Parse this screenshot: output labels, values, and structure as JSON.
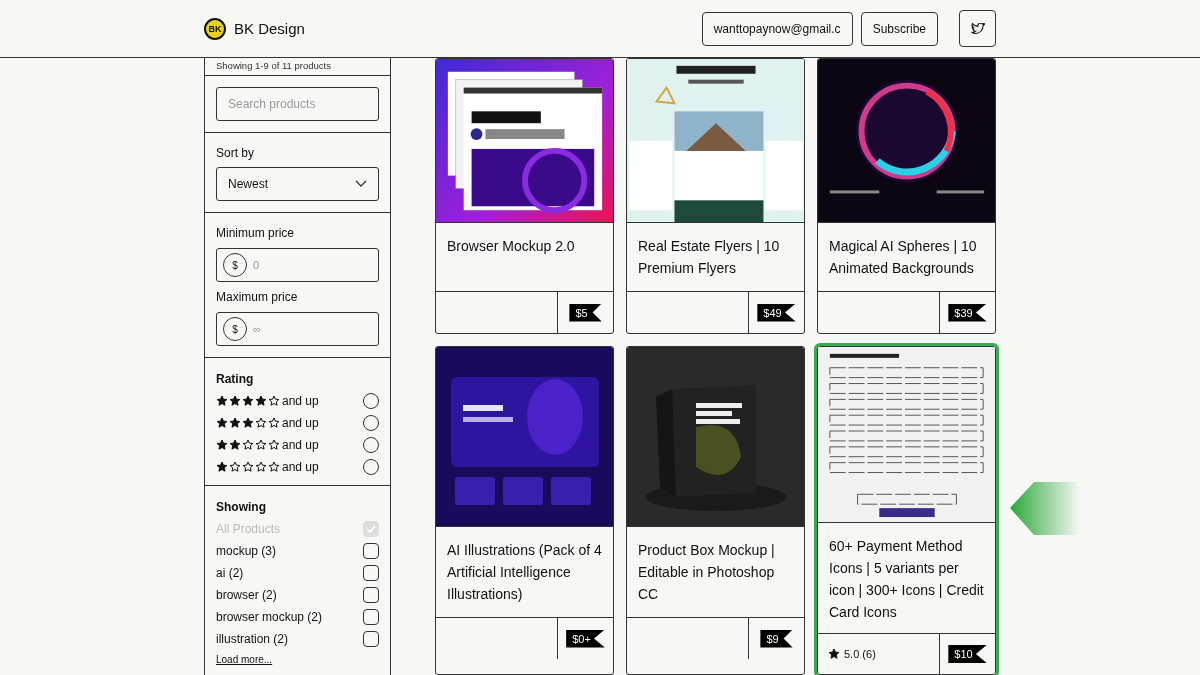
{
  "header": {
    "logo_text": "BK",
    "brand": "BK Design",
    "email": "wanttopaynow@gmail.c",
    "subscribe": "Subscribe"
  },
  "sidebar": {
    "result_count": "Showing 1-9 of 11 products",
    "search": {
      "placeholder": "Search products"
    },
    "sort": {
      "label": "Sort by",
      "value": "Newest"
    },
    "min_price": {
      "label": "Minimum price",
      "currency": "$",
      "placeholder": "0"
    },
    "max_price": {
      "label": "Maximum price",
      "currency": "$",
      "placeholder": "∞"
    },
    "rating": {
      "title": "Rating",
      "options": [
        {
          "stars": 4,
          "label": "and up",
          "selected": false
        },
        {
          "stars": 3,
          "label": "and up",
          "selected": false
        },
        {
          "stars": 2,
          "label": "and up",
          "selected": false
        },
        {
          "stars": 1,
          "label": "and up",
          "selected": false
        }
      ]
    },
    "showing": {
      "title": "Showing",
      "options": [
        {
          "label": "All Products",
          "checked": true,
          "disabled": true
        },
        {
          "label": "mockup (3)",
          "checked": false,
          "disabled": false
        },
        {
          "label": "ai (2)",
          "checked": false,
          "disabled": false
        },
        {
          "label": "browser (2)",
          "checked": false,
          "disabled": false
        },
        {
          "label": "browser mockup (2)",
          "checked": false,
          "disabled": false
        },
        {
          "label": "illustration (2)",
          "checked": false,
          "disabled": false
        }
      ],
      "load_more": "Load more..."
    }
  },
  "products": [
    {
      "title": "Browser Mockup 2.0",
      "price": "$5",
      "highlighted": false
    },
    {
      "title": "Real Estate Flyers | 10 Premium Flyers",
      "price": "$49",
      "highlighted": false
    },
    {
      "title": "Magical AI Spheres | 10 Animated Backgrounds",
      "price": "$39",
      "highlighted": false
    },
    {
      "title": "AI Illustrations (Pack of 4 Artificial Intelligence Illustrations)",
      "price": "$0+",
      "highlighted": false
    },
    {
      "title": "Product Box Mockup | Editable in Photoshop CC",
      "price": "$9",
      "highlighted": false
    },
    {
      "title": "60+ Payment Method Icons | 5 variants per icon | 300+ Icons | Credit Card Icons",
      "price": "$10",
      "rating": "5.0 (6)",
      "highlighted": true
    }
  ]
}
